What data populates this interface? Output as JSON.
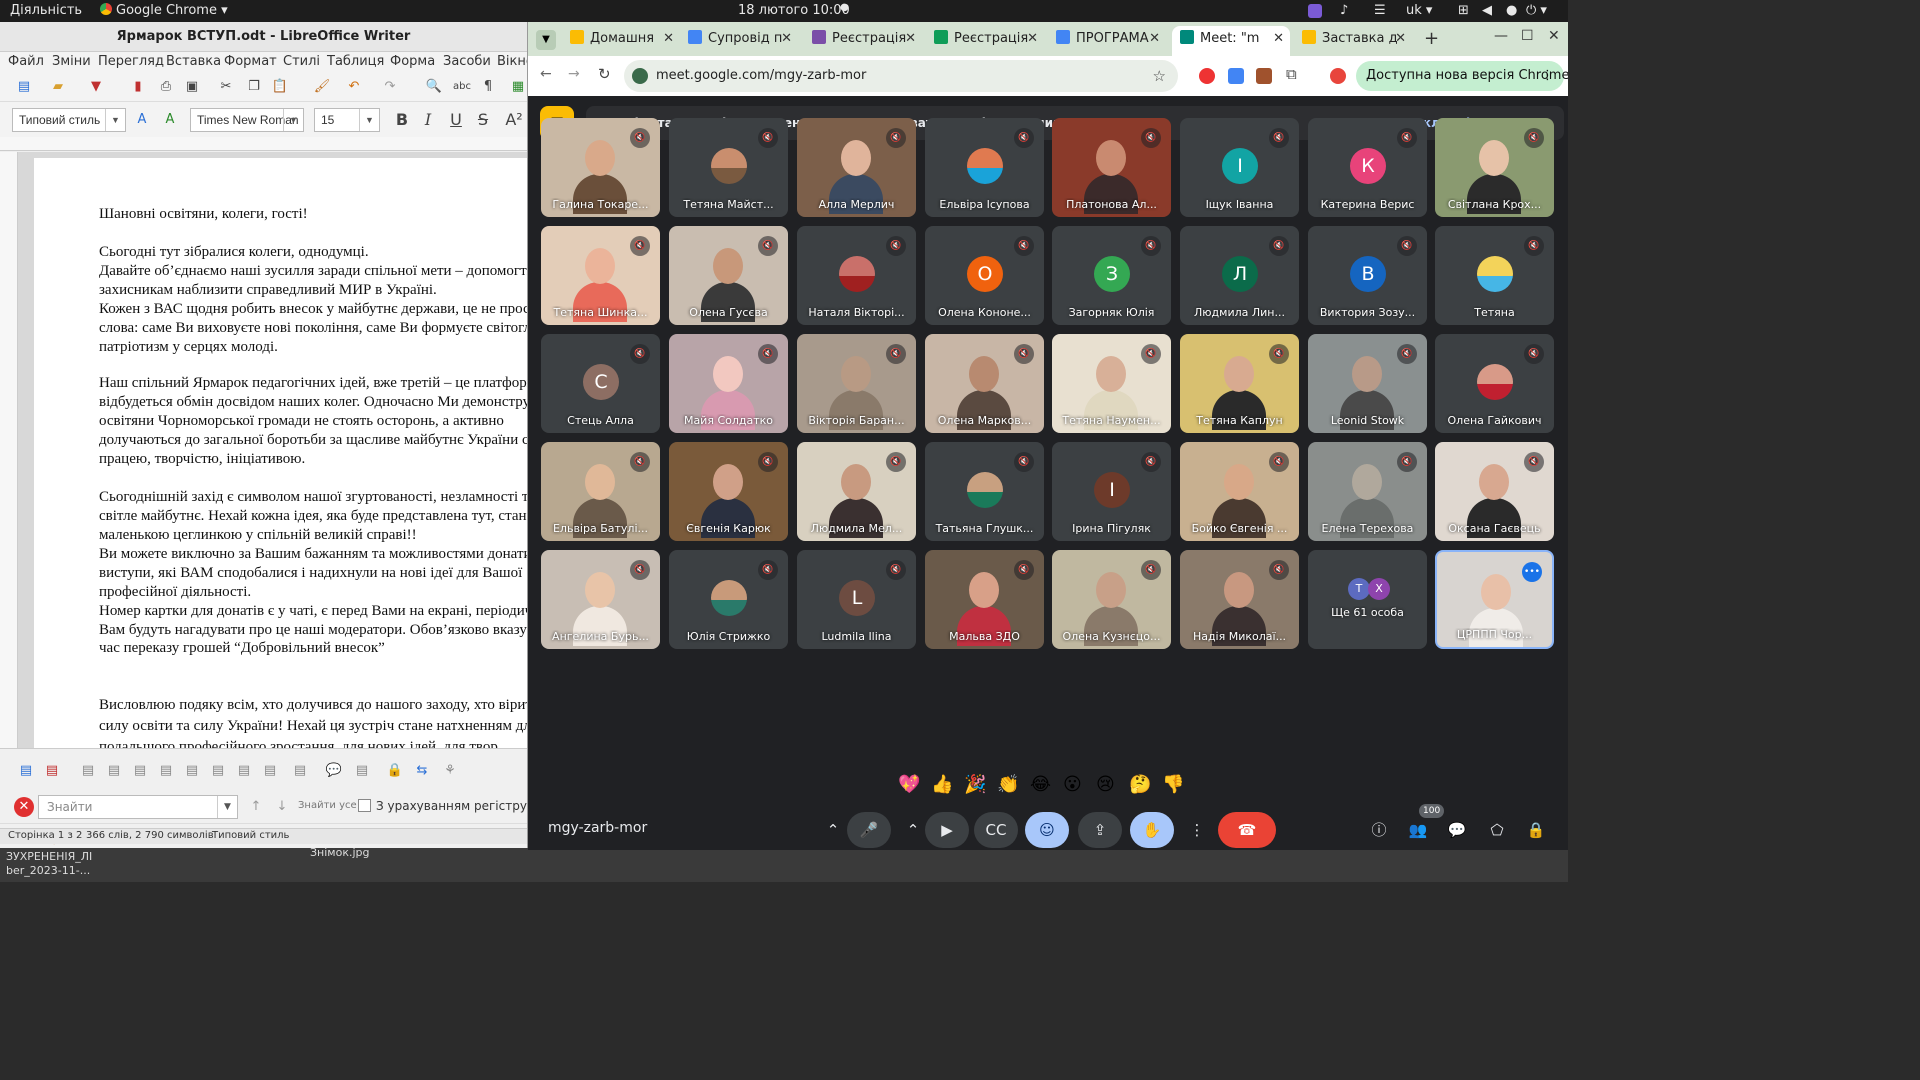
{
  "topbar": {
    "activities": "Діяльність",
    "app": "Google Chrome ▾",
    "clock": "18 лютого  10:00",
    "lang": "uk ▾",
    "tray_icons": [
      "network-icon",
      "volume-icon",
      "mic-icon",
      "power-icon"
    ]
  },
  "desktop": {
    "file1": "ЗУХРЕНЕНІЯ_ЛІ",
    "file1b": "ber_2023-11-...",
    "file2": "Знімок.jpg"
  },
  "writer": {
    "title": "Ярмарок ВСТУП.odt - LibreOffice Writer",
    "menu": [
      "Файл",
      "Зміни",
      "Перегляд",
      "Вставка",
      "Формат",
      "Стилі",
      "Таблиця",
      "Форма",
      "Засоби",
      "Вікно"
    ],
    "style_box": "Типовий стиль",
    "font_box": "Times New Roman",
    "size_box": "15",
    "doc_lines": [
      "Шановні освітяни, колеги, гості!",
      "",
      "Сьогодні тут зібралися  колеги, однодумці.",
      " Давайте об’єднаємо наші зусилля заради спільної мети – допомогти",
      "захисникам  наблизити справедливий МИР в Україні.",
      "Кожен з ВАС щодня робить внесок у майбутнє держави, це не просто",
      "слова: саме Ви виховуєте нові покоління, саме Ви формуєте світогляд,",
      "патріотизм у серцях молоді.",
      "",
      "Наш спільний Ярмарок педагогічних ідей, вже третій – це платформа, де",
      "відбудеться обмін досвідом наших колег. Одночасно Ми демонструємо, що",
      "освітяни Чорноморської громади не стоять осторонь, а активно",
      "долучаються до загальної боротьби за щасливе майбутнє України своєю",
      "працею, творчістю, ініціативою.",
      "",
      "Сьогоднішній захід є символом нашої згуртованості, незламності та віри у",
      "світле майбутнє. Нехай кожна ідея, яка буде представлена тут, стане",
      "маленькою цеглинкою у спільній великій справі!!",
      "Ви можете виключно за Вашим бажанням та можливостями донатити на",
      "виступи, які ВАМ сподобалися і надихнули на нові ідеї для Вашої",
      "професійної діяльності.",
      " Номер картки для донатів є у чаті, є перед Вами на екрані,  періодично",
      "Вам будуть нагадувати про це наші модератори. Обов’язково вказуйте під",
      "час переказу грошей “Добровільний внесок”",
      "",
      "",
      "Висловлюю подяку всім, хто долучився до нашого заходу, хто вірить у",
      "силу освіти та силу України! Нехай ця зустріч стане натхненням для",
      "подальшого  професійного зростання, для нових ідей, для твор"
    ],
    "find_placeholder": "Знайти",
    "find_all": "Знайти усе",
    "match_case": "З урахуванням регістру",
    "status": {
      "page": "Сторінка 1 з 2",
      "words": "366 слів, 2 790 символів",
      "style": "Типовий стиль"
    }
  },
  "chrome": {
    "tabs": [
      {
        "label": "Домашня",
        "color": "#fbbc04"
      },
      {
        "label": "Супровід п",
        "color": "#4285f4"
      },
      {
        "label": "Реєстрація",
        "color": "#7b4ea8"
      },
      {
        "label": "Реєстрація",
        "color": "#0f9d58"
      },
      {
        "label": "ПРОГРАМА",
        "color": "#4285f4"
      },
      {
        "label": "Meet: \"m",
        "color": "#00897b"
      },
      {
        "label": "Заставка д",
        "color": "#fbbc04"
      }
    ],
    "url": "meet.google.com/mgy-zarb-mor",
    "update": "Доступна нова версія Chrome"
  },
  "meet": {
    "banner": "Деякі встановлені розширення можуть впливати на якість виклику",
    "banner_more": "Докладніше",
    "banner_close": "Закрити",
    "participants": [
      {
        "name": "Галина Токаре...",
        "type": "video",
        "bg": "#c9b8a4",
        "skin": "#d9a98a",
        "cloth": "#6a4f3a"
      },
      {
        "name": "Тетяна Майст...",
        "type": "photo",
        "bg": "#3c4043",
        "skin": "#c98e6e",
        "cloth": "#7a5a40"
      },
      {
        "name": "Алла Мерлич",
        "type": "video",
        "bg": "#7c5f4a",
        "skin": "#e0b49b",
        "cloth": "#3b4a60"
      },
      {
        "name": "Ельвіра Ісупова",
        "type": "photo",
        "bg": "#3c4043",
        "skin": "#e07a50",
        "cloth": "#1aa3d9"
      },
      {
        "name": "Платонова Ал...",
        "type": "video",
        "bg": "#8a3a2a",
        "skin": "#c98a70",
        "cloth": "#3b2a2a"
      },
      {
        "name": "Іщук Іванна",
        "type": "avatar",
        "letter": "І",
        "color": "#12a4a4"
      },
      {
        "name": "Катерина Верис",
        "type": "avatar",
        "letter": "К",
        "color": "#e8437a"
      },
      {
        "name": "Світлана Крох...",
        "type": "video",
        "bg": "#8a9a70",
        "skin": "#e6c2a8",
        "cloth": "#2b2b2b"
      },
      {
        "name": "Тетяна Шинка...",
        "type": "video",
        "bg": "#e3cdb8",
        "skin": "#ebb49a",
        "cloth": "#e86a5a"
      },
      {
        "name": "Олена Гусєва",
        "type": "video",
        "bg": "#c9bdb0",
        "skin": "#c8987a",
        "cloth": "#3a3a3a"
      },
      {
        "name": "Наталя Вікторі...",
        "type": "photo",
        "bg": "#3c4043",
        "skin": "#c9706a",
        "cloth": "#a02020"
      },
      {
        "name": "Олена Кононе...",
        "type": "avatar",
        "letter": "О",
        "color": "#f0620e"
      },
      {
        "name": "Загорняк Юлія",
        "type": "avatar",
        "letter": "З",
        "color": "#34a853"
      },
      {
        "name": "Людмила Лин...",
        "type": "avatar",
        "letter": "Л",
        "color": "#0b6b4a"
      },
      {
        "name": "Виктория Зозу...",
        "type": "avatar",
        "letter": "В",
        "color": "#1565c0"
      },
      {
        "name": "Тетяна",
        "type": "photo",
        "bg": "#3c4043",
        "skin": "#f3d35a",
        "cloth": "#46b6e6"
      },
      {
        "name": "Стець Алла",
        "type": "avatar",
        "letter": "С",
        "color": "#8d6e63"
      },
      {
        "name": "Майя Солдатко",
        "type": "video",
        "bg": "#b8a4a8",
        "skin": "#f2c8c0",
        "cloth": "#d89ab0"
      },
      {
        "name": "Вікторія Баран...",
        "type": "video",
        "bg": "#a89a8c",
        "skin": "#b89a84",
        "cloth": "#8a7a6a"
      },
      {
        "name": "Олена Марков...",
        "type": "video",
        "bg": "#c8b6a6",
        "skin": "#b88a70",
        "cloth": "#5a4a40"
      },
      {
        "name": "Тетяна Наумен...",
        "type": "video",
        "bg": "#e8e0d0",
        "skin": "#d8b098",
        "cloth": "#e0d8c0"
      },
      {
        "name": "Тетяна Каплун",
        "type": "video",
        "bg": "#d8c070",
        "skin": "#d8aa90",
        "cloth": "#2a2a2a"
      },
      {
        "name": "Leonid Stowk",
        "type": "video",
        "bg": "#8a9090",
        "skin": "#b89a88",
        "cloth": "#4a4a4a"
      },
      {
        "name": "Олена Гайкович",
        "type": "photo",
        "bg": "#3c4043",
        "skin": "#d89a88",
        "cloth": "#c02030"
      },
      {
        "name": "Ельвіра Батулі...",
        "type": "video",
        "bg": "#b8a890",
        "skin": "#e0b898",
        "cloth": "#6a5a4a"
      },
      {
        "name": "Євгенія Карюк",
        "type": "video",
        "bg": "#7a5a3a",
        "skin": "#d0a088",
        "cloth": "#2a3040"
      },
      {
        "name": "Людмила Мел...",
        "type": "video",
        "bg": "#d8d0c0",
        "skin": "#c89a80",
        "cloth": "#3a3030"
      },
      {
        "name": "Татьяна Глушк...",
        "type": "photo",
        "bg": "#3c4043",
        "skin": "#c8a080",
        "cloth": "#1a7a5a"
      },
      {
        "name": "Ірина Пігуляк",
        "type": "avatar",
        "letter": "І",
        "color": "#6d3a2a"
      },
      {
        "name": "Бойко Євгенія ...",
        "type": "video",
        "bg": "#c8b090",
        "skin": "#d8a888",
        "cloth": "#4a3a30"
      },
      {
        "name": "Елена Терехова",
        "type": "video",
        "bg": "#8a8e8c",
        "skin": "#b0a89c",
        "cloth": "#6a6e6c"
      },
      {
        "name": "Оксана Гаєвець",
        "type": "video",
        "bg": "#e0d8d0",
        "skin": "#d8a890",
        "cloth": "#2a2a2a"
      },
      {
        "name": "Ангелина Бурь...",
        "type": "video",
        "bg": "#c8beb4",
        "skin": "#e8c4a8",
        "cloth": "#f0e8e0"
      },
      {
        "name": "Юлія Стрижко",
        "type": "photo",
        "bg": "#3c4043",
        "skin": "#c89a7a",
        "cloth": "#2a7a6a"
      },
      {
        "name": "Ludmila Ilina",
        "type": "avatar",
        "letter": "L",
        "color": "#6d4c41"
      },
      {
        "name": "Мальва ЗДО",
        "type": "video",
        "bg": "#6a5a4a",
        "skin": "#d8a088",
        "cloth": "#c03040"
      },
      {
        "name": "Олена Кузнєцо...",
        "type": "video",
        "bg": "#c0b8a0",
        "skin": "#c8a088",
        "cloth": "#8a7a6a"
      },
      {
        "name": "Надія Миколаї...",
        "type": "video",
        "bg": "#8a7a6a",
        "skin": "#c89880",
        "cloth": "#3a3030"
      },
      {
        "name": "Ще 61 особа",
        "type": "more"
      },
      {
        "name": "ЦРППП Чор...",
        "type": "me",
        "bg": "#d8d4d0",
        "skin": "#e8c0a8",
        "cloth": "#f0ece8"
      }
    ],
    "reactions": [
      "💖",
      "👍",
      "🎉",
      "👏",
      "😂",
      "😮",
      "😢",
      "🤔",
      "👎"
    ],
    "meeting_code": "mgy-zarb-mor",
    "people_count": "100"
  }
}
